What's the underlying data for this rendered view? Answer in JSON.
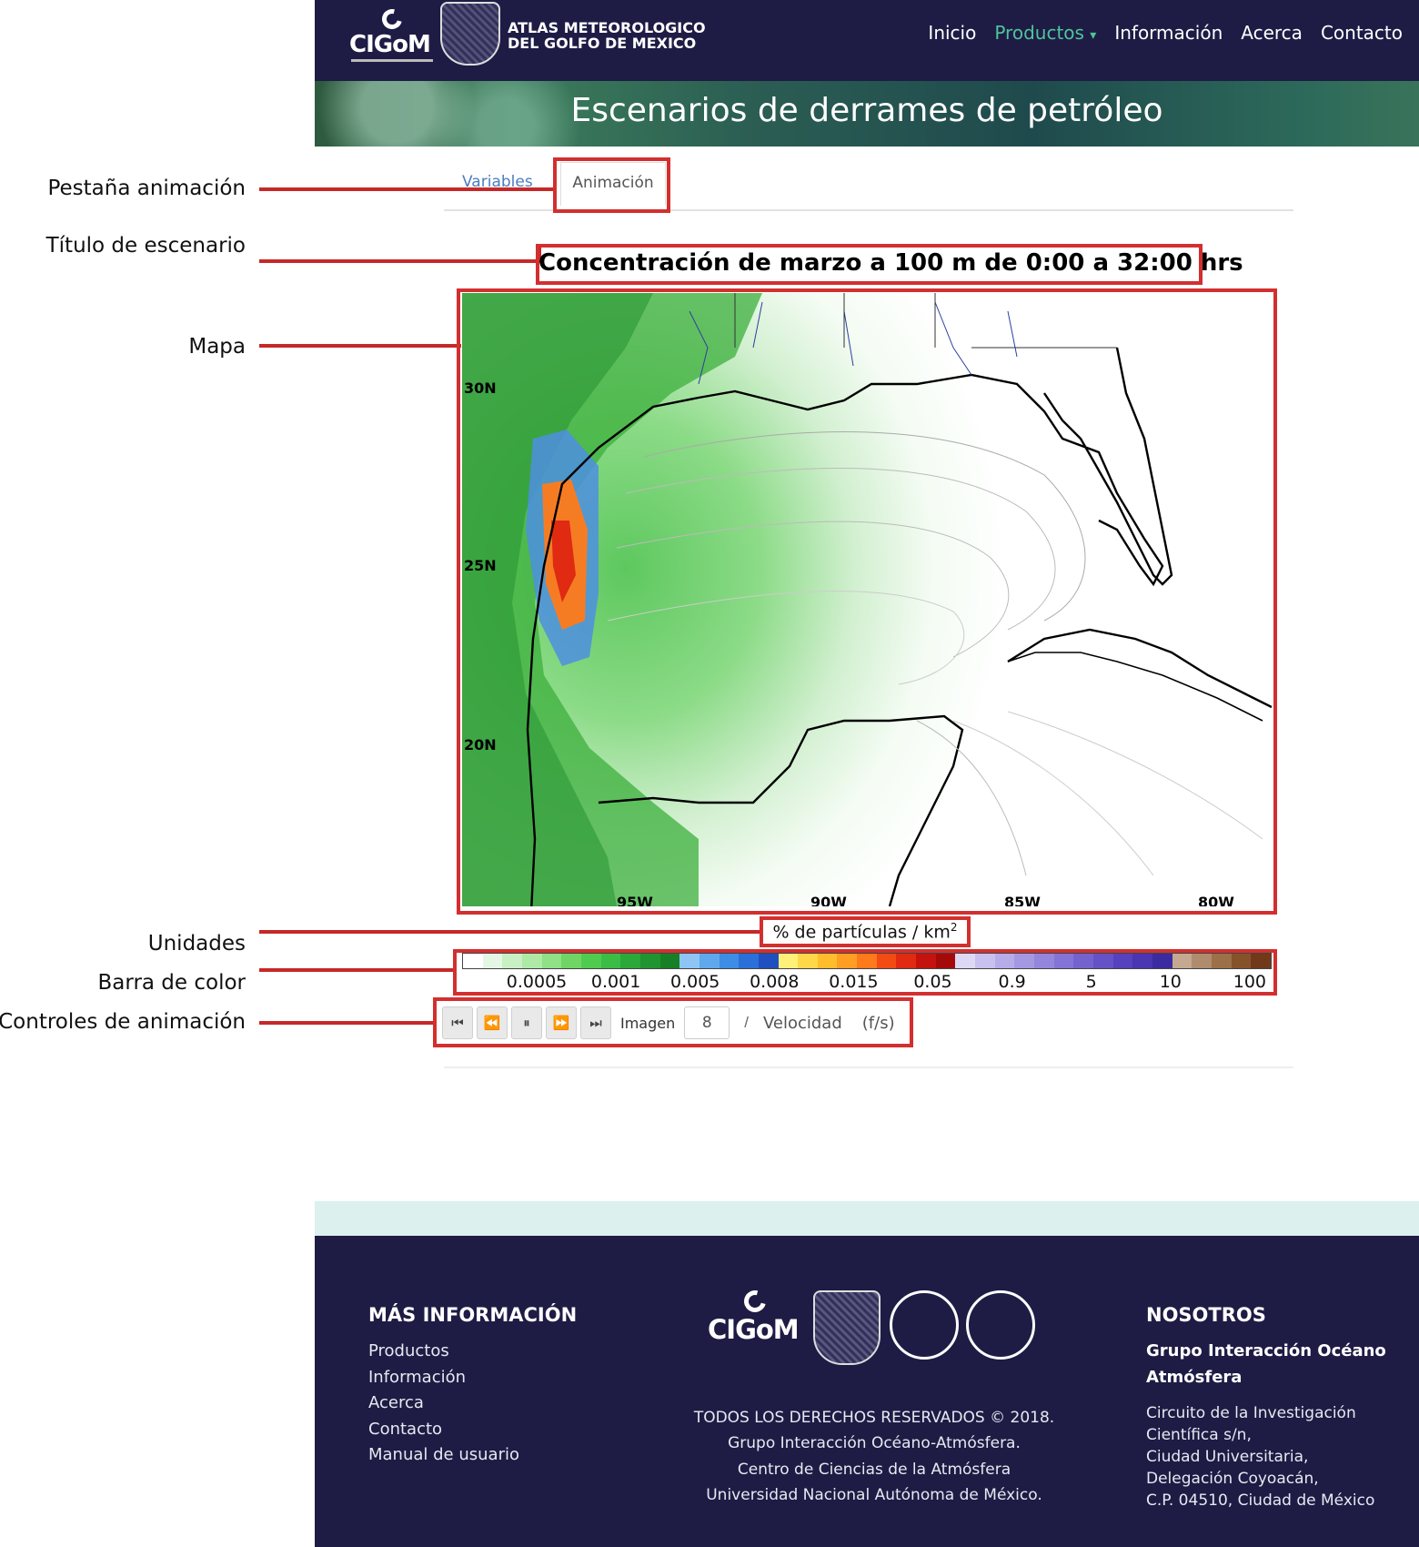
{
  "annotations": {
    "tab": "Pestaña animación",
    "title": "Título de escenario",
    "map": "Mapa",
    "units": "Unidades",
    "colorbar": "Barra de color",
    "controls": "Controles de animación"
  },
  "header": {
    "logo_text": "CIGoM",
    "site_title_line1": "ATLAS METEOROLOGICO",
    "site_title_line2": "DEL GOLFO DE MEXICO",
    "nav": [
      "Inicio",
      "Productos",
      "Información",
      "Acerca",
      "Contacto"
    ],
    "nav_active": "Productos",
    "dropdown_caret": "▾"
  },
  "banner": {
    "title": "Escenarios de derrames de petróleo"
  },
  "tabs": {
    "variables": "Variables",
    "animation": "Animación"
  },
  "scenario_title": "Concentración de marzo a  100 m de 0:00 a 32:00 hrs",
  "map": {
    "lat_labels": [
      "30N",
      "25N",
      "20N"
    ],
    "lon_labels": [
      "95W",
      "90W",
      "85W",
      "80W"
    ]
  },
  "units": {
    "text": "% de partículas / km",
    "exp": "2"
  },
  "colorbar": {
    "colors": [
      "#ffffff",
      "#e4f7e4",
      "#c8f0c4",
      "#aeeaa6",
      "#8fe087",
      "#6fd666",
      "#4fcc4f",
      "#3bbd45",
      "#2aa83a",
      "#1f9430",
      "#178026",
      "#8ec5f4",
      "#5fa8ee",
      "#3d8de6",
      "#2b6fd9",
      "#2050c0",
      "#fff07a",
      "#ffd84a",
      "#ffbd2e",
      "#ff9e22",
      "#ff7a1a",
      "#f24b14",
      "#e02a12",
      "#c4120f",
      "#a50a0a",
      "#ddd8f4",
      "#c8c0ee",
      "#b6ace8",
      "#a598e2",
      "#9486dc",
      "#8474d6",
      "#7462ce",
      "#6552c6",
      "#5642bd",
      "#4a35b2",
      "#3b2aa0",
      "#c4a890",
      "#b08c6e",
      "#9c7048",
      "#86522a",
      "#703a1a"
    ],
    "ticks": [
      "0.0005",
      "0.001",
      "0.005",
      "0.008",
      "0.015",
      "0.05",
      "0.9",
      "5",
      "10",
      "100"
    ]
  },
  "controls": {
    "first_icon": "first-frame-icon",
    "prev_icon": "rewind-icon",
    "pause_icon": "pause-icon",
    "next_icon": "fast-forward-icon",
    "last_icon": "last-frame-icon",
    "frame_label": "Imagen",
    "frame_value": "8",
    "separator": "/",
    "speed_label": "Velocidad",
    "speed_unit": "(f/s)"
  },
  "footer": {
    "more_info_title": "MÁS INFORMACIÓN",
    "links": [
      "Productos",
      "Información",
      "Acerca",
      "Contacto",
      "Manual de usuario"
    ],
    "logo_text": "CIGoM",
    "copyright": [
      "TODOS LOS DERECHOS RESERVADOS © 2018.",
      "Grupo Interacción Océano-Atmósfera.",
      "Centro de Ciencias de la Atmósfera",
      "Universidad Nacional Autónoma de México."
    ],
    "about_title": "NOSOTROS",
    "group_name_1": "Grupo Interacción Océano",
    "group_name_2": "Atmósfera",
    "address": [
      "Circuito de la Investigación",
      "Científica s/n,",
      "Ciudad Universitaria,",
      "Delegación Coyoacán,",
      "C.P. 04510, Ciudad de México"
    ]
  }
}
